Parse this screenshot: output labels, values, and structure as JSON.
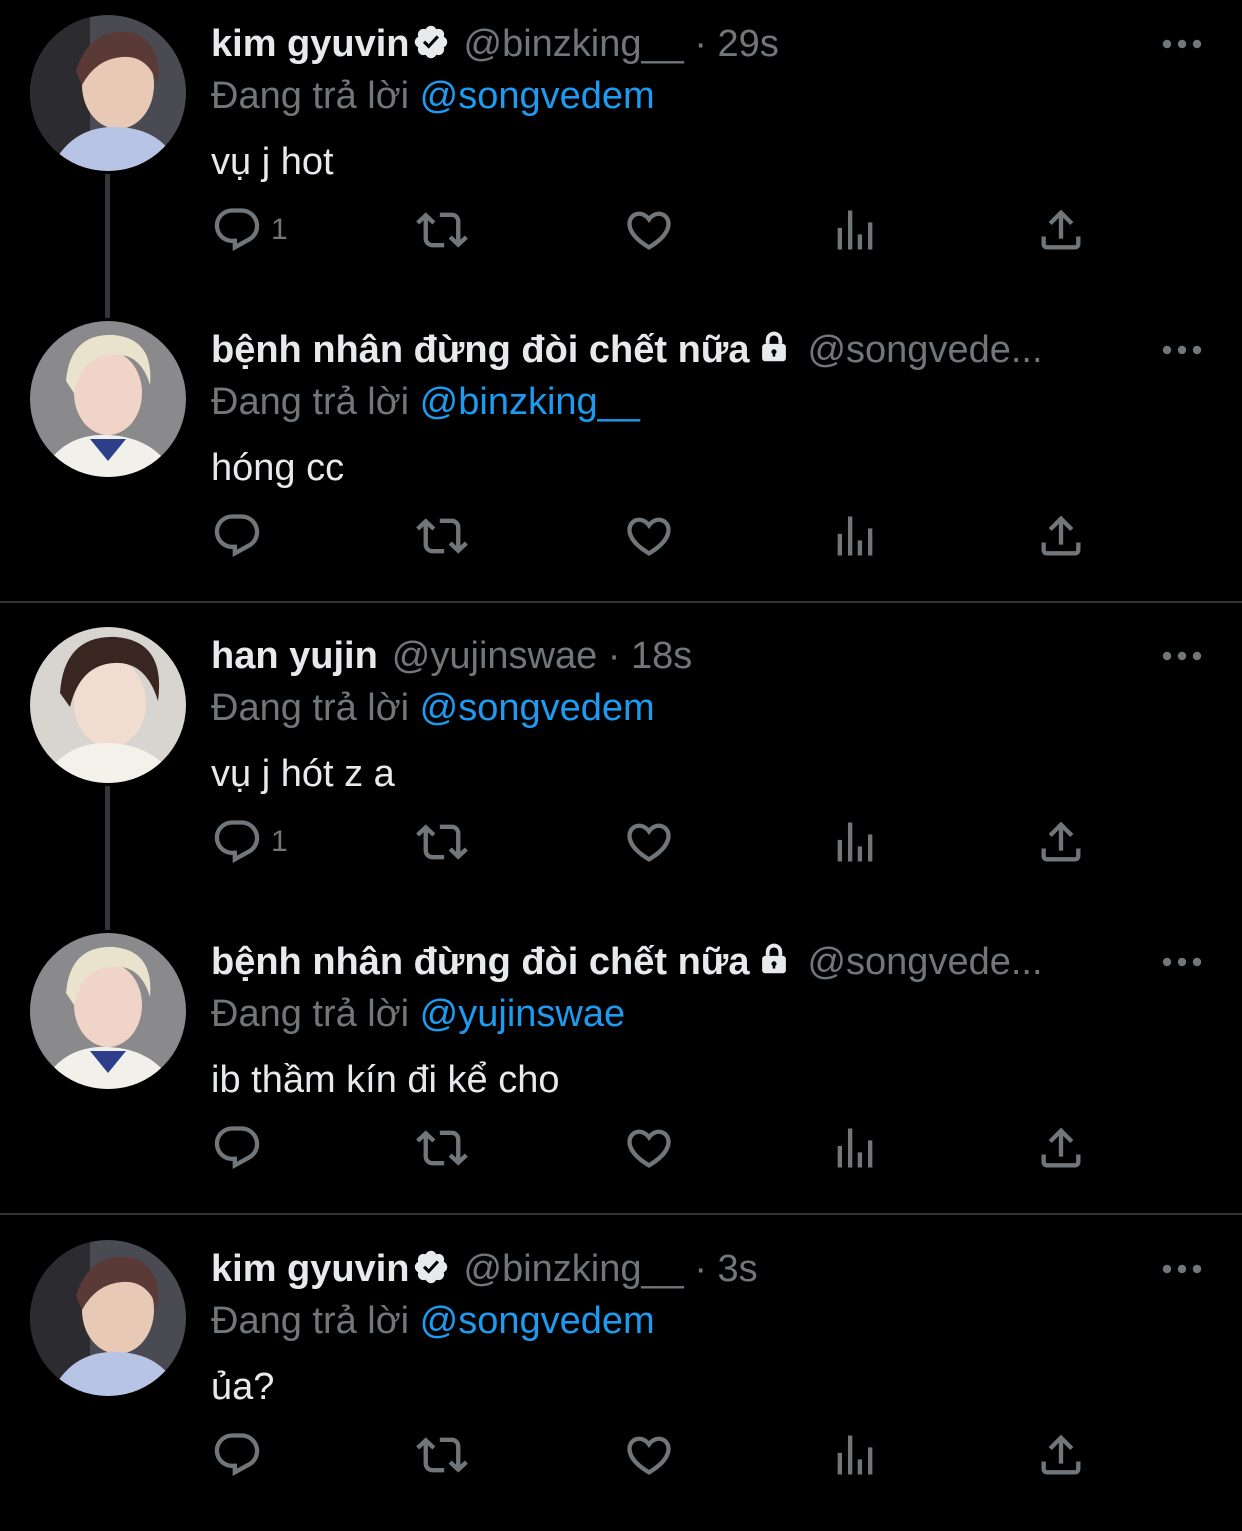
{
  "icons": {
    "more": "more-icon",
    "reply": "reply-icon",
    "retweet": "retweet-icon",
    "like": "like-icon",
    "views": "views-icon",
    "share": "share-icon",
    "verified": "verified-badge-icon",
    "lock": "lock-icon"
  },
  "colors": {
    "background": "#000000",
    "text": "#e7e9ea",
    "muted": "#71767b",
    "mention": "#1d9bf0",
    "divider": "#2f3336"
  },
  "tweets": [
    {
      "name": "kim gyuvin",
      "handle": "@binzking__",
      "dot": " · ",
      "time": "29s",
      "replying_prefix": "Đang trả lời ",
      "replying_to": "@songvedem",
      "text": "vụ j hot",
      "reply_count": "1"
    },
    {
      "name": "bệnh nhân đừng đòi chết nữa",
      "handle": "@songvede...",
      "replying_prefix": "Đang trả lời ",
      "replying_to": "@binzking__",
      "text": "hóng cc",
      "reply_count": ""
    },
    {
      "name": "han yujin",
      "handle": "@yujinswae",
      "dot": " · ",
      "time": "18s",
      "replying_prefix": "Đang trả lời ",
      "replying_to": "@songvedem",
      "text": "vụ j hót z a",
      "reply_count": "1"
    },
    {
      "name": "bệnh nhân đừng đòi chết nữa",
      "handle": "@songvede...",
      "replying_prefix": "Đang trả lời ",
      "replying_to": "@yujinswae",
      "text": "ib thầm kín đi kể cho",
      "reply_count": ""
    },
    {
      "name": "kim gyuvin",
      "handle": "@binzking__",
      "dot": " · ",
      "time": "3s",
      "replying_prefix": "Đang trả lời ",
      "replying_to": "@songvedem",
      "text": "ủa?",
      "reply_count": ""
    }
  ]
}
